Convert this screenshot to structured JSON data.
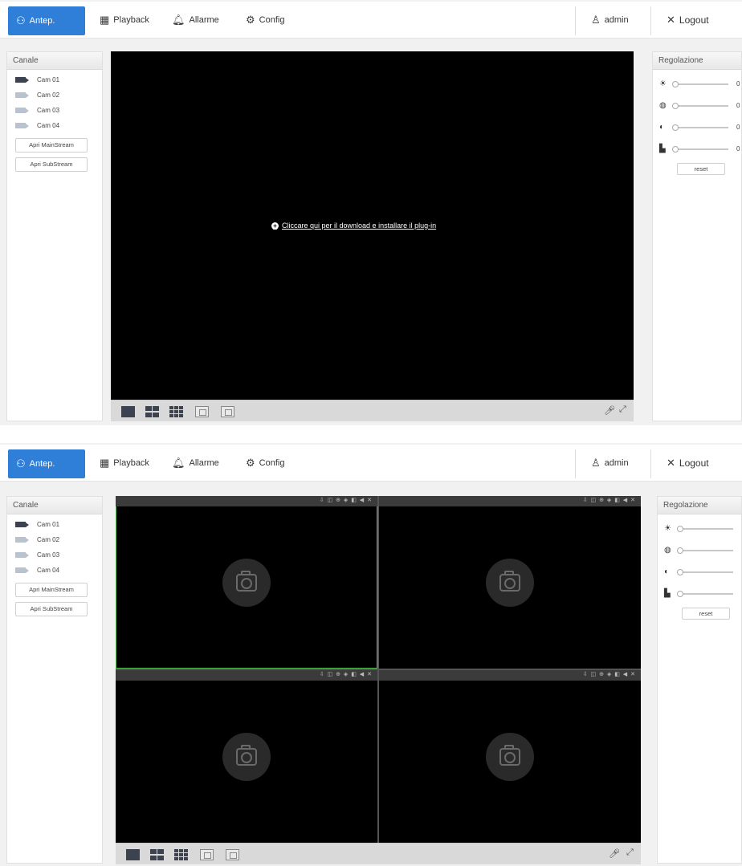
{
  "nav": {
    "antep": "Antep.",
    "playback": "Playback",
    "allarme": "Allarme",
    "config": "Config",
    "admin": "admin",
    "logout": "Logout"
  },
  "channels": {
    "title": "Canale",
    "cams": [
      "Cam 01",
      "Cam 02",
      "Cam 03",
      "Cam 04"
    ],
    "main_stream": "Apri MainStream",
    "sub_stream": "Apri SubStream"
  },
  "adjust": {
    "title": "Regolazione",
    "values": [
      "0",
      "0",
      "0",
      "0"
    ],
    "levels": [
      0,
      0,
      0,
      0
    ],
    "reset": "reset"
  },
  "plugin_message": "Cliccare qui per il download e installare il plug-in",
  "icons": {
    "cell_tools": "⇩ ◫ ⊕ ◈ ◧ ◀ ✕"
  },
  "colors": {
    "accent": "#2f7fd8",
    "selected_cell": "#4fb84f"
  }
}
